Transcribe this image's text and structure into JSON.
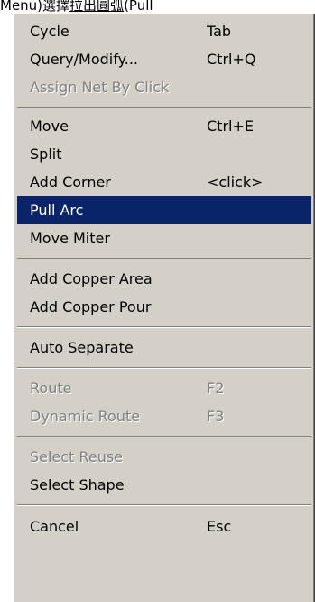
{
  "background_caption": {
    "prefix": "Menu)選擇",
    "underlined": "拉出圓弧",
    "suffix": "(Pull"
  },
  "menu": {
    "items": [
      {
        "label": "Cycle",
        "shortcut": "Tab",
        "state": "enabled"
      },
      {
        "label": "Query/Modify...",
        "shortcut": "Ctrl+Q",
        "state": "enabled"
      },
      {
        "label": "Assign Net By Click",
        "shortcut": "",
        "state": "disabled"
      },
      {
        "label": "Move",
        "shortcut": "Ctrl+E",
        "state": "enabled"
      },
      {
        "label": "Split",
        "shortcut": "",
        "state": "enabled"
      },
      {
        "label": "Add Corner",
        "shortcut": "<click>",
        "state": "enabled"
      },
      {
        "label": "Pull Arc",
        "shortcut": "",
        "state": "highlighted"
      },
      {
        "label": "Move Miter",
        "shortcut": "",
        "state": "enabled"
      },
      {
        "label": "Add Copper Area",
        "shortcut": "",
        "state": "enabled"
      },
      {
        "label": "Add Copper Pour",
        "shortcut": "",
        "state": "enabled"
      },
      {
        "label": "Auto Separate",
        "shortcut": "",
        "state": "enabled"
      },
      {
        "label": "Route",
        "shortcut": "F2",
        "state": "disabled"
      },
      {
        "label": "Dynamic Route",
        "shortcut": "F3",
        "state": "disabled"
      },
      {
        "label": "Select Reuse",
        "shortcut": "",
        "state": "disabled"
      },
      {
        "label": "Select Shape",
        "shortcut": "",
        "state": "enabled"
      },
      {
        "label": "Cancel",
        "shortcut": "Esc",
        "state": "enabled"
      }
    ]
  },
  "colors": {
    "menu_background": "#d4d0c8",
    "highlight_background": "#0a246a",
    "highlight_text": "#ffffff",
    "disabled_text": "#808080"
  }
}
